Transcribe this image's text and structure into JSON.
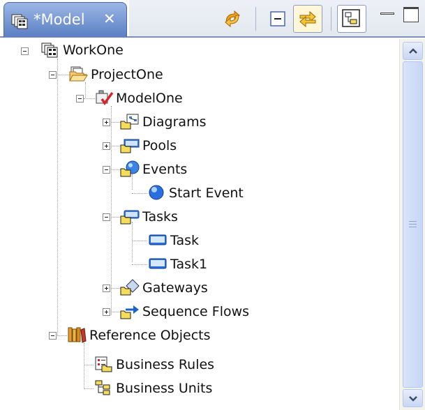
{
  "tab": {
    "title": "*Model",
    "close_glyph": "✕",
    "icon": "model-icon"
  },
  "toolbar": {
    "buttons": [
      "sync-icon",
      "collapse-all-icon",
      "link-with-editor-icon",
      "show-hierarchy-icon",
      "minimize-icon",
      "maximize-icon"
    ]
  },
  "tree": {
    "workone": "WorkOne",
    "projectone": "ProjectOne",
    "modelone": "ModelOne",
    "diagrams": "Diagrams",
    "pools": "Pools",
    "events": "Events",
    "start_event": "Start Event",
    "tasks": "Tasks",
    "task": "Task",
    "task1": "Task1",
    "gateways": "Gateways",
    "sequence_flows": "Sequence Flows",
    "reference_objects": "Reference Objects",
    "business_rules": "Business Rules",
    "business_units": "Business Units"
  },
  "colors": {
    "tab_active": "#5b7fc3",
    "folder": "#f5dc5a",
    "event_blue": "#2a6fe0",
    "selection_border": "#7d8fb6"
  }
}
